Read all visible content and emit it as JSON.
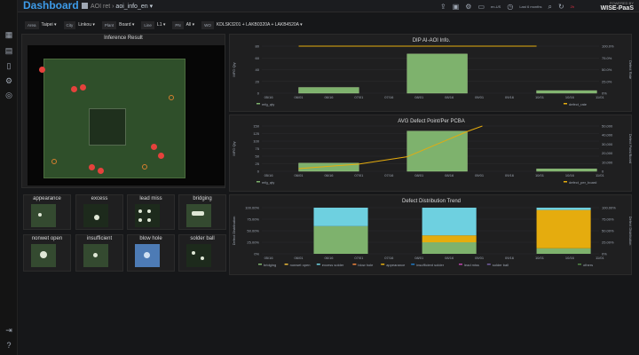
{
  "app": {
    "logo": "Dashboard",
    "breadcrumb_folder": "AOI ret",
    "breadcrumb_page": "aoi_info_en",
    "time_range": "Last 6 months",
    "refresh": "2h",
    "powered_line1": "POWERED BY",
    "powered_line2": "WISE-PaaS",
    "small_badge": "en-US"
  },
  "filters": [
    {
      "label": "Area",
      "value": "Taipei"
    },
    {
      "label": "City",
      "value": "Linkou"
    },
    {
      "label": "Plant",
      "value": "Board"
    },
    {
      "label": "Line",
      "value": "L1"
    },
    {
      "label": "PN",
      "value": "All"
    },
    {
      "label": "WO",
      "value": "KDLSK3201 + LAKB0320A + LAKB4520A"
    }
  ],
  "inference": {
    "title": "Inference Result"
  },
  "defects": [
    {
      "label": "appearance",
      "style": "appearance"
    },
    {
      "label": "excess",
      "style": "excess"
    },
    {
      "label": "lead miss",
      "style": "leadmiss"
    },
    {
      "label": "bridging",
      "style": "bridging"
    },
    {
      "label": "nonwet open",
      "style": "nonwet"
    },
    {
      "label": "insufficient",
      "style": "insufficient"
    },
    {
      "label": "blow hole",
      "style": "blowhole"
    },
    {
      "label": "solder ball",
      "style": "solderball"
    }
  ],
  "chart_data": [
    {
      "type": "bar",
      "title": "DIP AI-AOI Info.",
      "ylabel": "MFG Qty",
      "y2label": "Defect Rate",
      "x_ticks": [
        "05/16",
        "06/01",
        "06/16",
        "07/01",
        "07/16",
        "08/01",
        "08/16",
        "09/01",
        "09/16",
        "10/01",
        "10/16",
        "11/01"
      ],
      "y_ticks": [
        "80",
        "60",
        "40",
        "20",
        "0"
      ],
      "y2_ticks": [
        "100.0%",
        "75.0%",
        "50.0%",
        "25.0%",
        "0%"
      ],
      "ylim": [
        0,
        90
      ],
      "series": [
        {
          "name": "mfg_qty",
          "color": "#7eb26d",
          "kind": "bar",
          "bars": [
            {
              "start": 1.0,
              "end": 3.0,
              "value": 11
            },
            {
              "start": 4.6,
              "end": 6.6,
              "value": 75
            },
            {
              "start": 8.9,
              "end": 10.9,
              "value": 5
            }
          ]
        },
        {
          "name": "defect_rate",
          "color": "#e5ac0e",
          "kind": "line",
          "y2": true,
          "points": [
            [
              1.0,
              100
            ],
            [
              8.9,
              100
            ]
          ]
        }
      ]
    },
    {
      "type": "bar",
      "title": "AVG Defect Point/Per PCBA",
      "ylabel": "MFG Qty",
      "y2label": "Defect Point/Board",
      "x_ticks": [
        "05/16",
        "06/01",
        "06/16",
        "07/01",
        "07/16",
        "08/01",
        "08/16",
        "09/01",
        "09/16",
        "10/01",
        "10/16",
        "11/01"
      ],
      "y_ticks": [
        "150",
        "125",
        "100",
        "75",
        "50",
        "25",
        "0"
      ],
      "y2_ticks": [
        "50,000",
        "40,000",
        "30,000",
        "20,000",
        "10,000",
        "0"
      ],
      "ylim": [
        0,
        150
      ],
      "series": [
        {
          "name": "mfg_qty",
          "color": "#7eb26d",
          "kind": "bar",
          "bars": [
            {
              "start": 1.0,
              "end": 3.0,
              "value": 27
            },
            {
              "start": 4.6,
              "end": 6.6,
              "value": 133
            },
            {
              "start": 8.9,
              "end": 10.9,
              "value": 8
            }
          ]
        },
        {
          "name": "defect_per_board",
          "color": "#e5ac0e",
          "kind": "line",
          "y2": true,
          "y2max": 50000,
          "points": [
            [
              1.0,
              3000
            ],
            [
              3.0,
              8000
            ],
            [
              4.6,
              16000
            ],
            [
              6.6,
              44000
            ],
            [
              7.1,
              50000
            ]
          ]
        }
      ]
    },
    {
      "type": "bar",
      "title": "Defect Distribution Trend",
      "ylabel": "Defect Distribution",
      "y2label": "Defect Distribution",
      "x_ticks": [
        "05/16",
        "06/01",
        "06/16",
        "07/01",
        "07/16",
        "08/01",
        "08/16",
        "09/01",
        "09/16",
        "10/01",
        "10/16",
        "11/01"
      ],
      "y_ticks": [
        "100.00%",
        "75.00%",
        "50.00%",
        "25.00%",
        "0%"
      ],
      "y2_ticks": [
        "100.00%",
        "75.00%",
        "50.00%",
        "25.00%",
        "0%"
      ],
      "ylim": [
        0,
        100
      ],
      "stacks": [
        {
          "start": 1.5,
          "end": 3.3,
          "segments": [
            {
              "name": "bridging",
              "value": 60
            },
            {
              "name": "excess solder",
              "value": 40
            }
          ]
        },
        {
          "start": 5.1,
          "end": 6.9,
          "segments": [
            {
              "name": "bridging",
              "value": 25
            },
            {
              "name": "appearance",
              "value": 15
            },
            {
              "name": "excess solder",
              "value": 60
            }
          ]
        },
        {
          "start": 8.9,
          "end": 10.7,
          "segments": [
            {
              "name": "bridging",
              "value": 12
            },
            {
              "name": "appearance",
              "value": 83
            },
            {
              "name": "excess solder",
              "value": 5
            }
          ]
        }
      ],
      "legend": [
        {
          "name": "bridging",
          "color": "#7eb26d"
        },
        {
          "name": "nonwet open",
          "color": "#eab839"
        },
        {
          "name": "excess solder",
          "color": "#6ed0e0"
        },
        {
          "name": "blow hole",
          "color": "#ef843c"
        },
        {
          "name": "appearance",
          "color": "#e5ac0e"
        },
        {
          "name": "insufficient solder",
          "color": "#1f78c1"
        },
        {
          "name": "lead miss",
          "color": "#ba43a9"
        },
        {
          "name": "solder ball",
          "color": "#705da0"
        },
        {
          "name": "others",
          "color": "#508642"
        }
      ]
    }
  ]
}
